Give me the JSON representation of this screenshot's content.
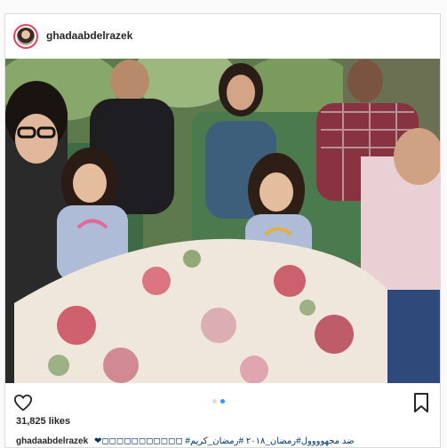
{
  "post": {
    "username": "ghadaabdelrazek",
    "likes": "31,825 likes",
    "caption_user": "ghadaabdelrazek",
    "caption_text": "ضد مجهوووول#رمضان_٢٠١٨ #رمضان_كريم# ◻◻◻◻◻◻◻◻◻◻◻❤"
  },
  "photo": {
    "alt": "Family seated around a floral tablecloth table in a garden"
  },
  "carousel": {
    "count": 2,
    "active_index": 1
  },
  "colors": {
    "story_ring": "#e4405f",
    "active_dot": "#3897f0",
    "border": "#dbdbdb"
  },
  "icons": {
    "like": "heart-icon",
    "save": "bookmark-icon"
  }
}
